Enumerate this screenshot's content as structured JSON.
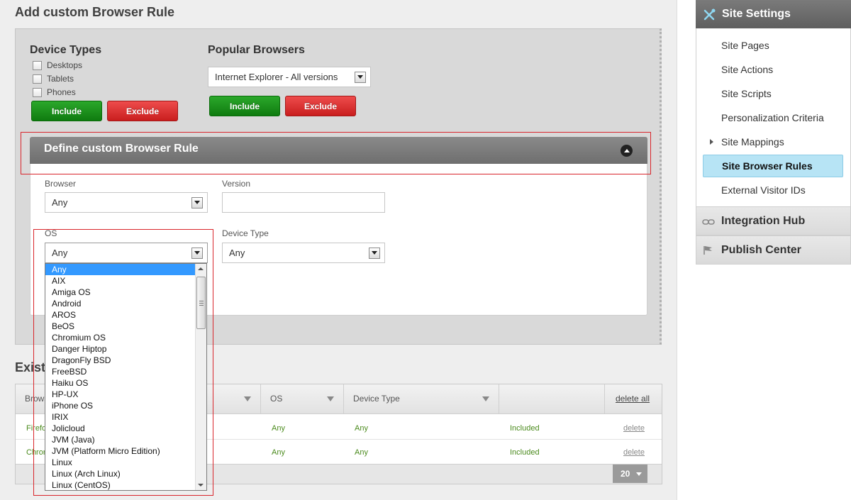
{
  "page": {
    "title": "Add custom Browser Rule",
    "existing_title": "Existing Browser Rules"
  },
  "device_types": {
    "heading": "Device Types",
    "options": [
      "Desktops",
      "Tablets",
      "Phones"
    ],
    "include_label": "Include",
    "exclude_label": "Exclude"
  },
  "popular_browsers": {
    "heading": "Popular Browsers",
    "selected": "Internet Explorer - All versions",
    "include_label": "Include",
    "exclude_label": "Exclude"
  },
  "define_rule": {
    "title": "Define custom Browser Rule",
    "browser_label": "Browser",
    "browser_value": "Any",
    "version_label": "Version",
    "version_value": "",
    "os_label": "OS",
    "os_value": "Any",
    "device_type_label": "Device Type",
    "device_type_value": "Any",
    "os_options": [
      "Any",
      "AIX",
      "Amiga OS",
      "Android",
      "AROS",
      "BeOS",
      "Chromium OS",
      "Danger Hiptop",
      "DragonFly BSD",
      "FreeBSD",
      "Haiku OS",
      "HP-UX",
      "iPhone OS",
      "IRIX",
      "Jolicloud",
      "JVM (Java)",
      "JVM (Platform Micro Edition)",
      "Linux",
      "Linux (Arch Linux)",
      "Linux (CentOS)"
    ]
  },
  "table": {
    "headers": {
      "browser": "Browser",
      "os": "OS",
      "device_type": "Device Type",
      "delete_all": "delete all"
    },
    "rows": [
      {
        "browser": "Firefox",
        "os": "Any",
        "device_type": "Any",
        "status": "Included",
        "action": "delete"
      },
      {
        "browser": "Chrome",
        "os": "Any",
        "device_type": "Any",
        "status": "Included",
        "action": "delete"
      }
    ],
    "page_size": "20"
  },
  "sidebar": {
    "header": "Site Settings",
    "header_icon": "tools-icon",
    "items": [
      "Site Pages",
      "Site Actions",
      "Site Scripts",
      "Personalization Criteria",
      "Site Mappings",
      "Site Browser Rules",
      "External Visitor IDs"
    ],
    "active": "Site Browser Rules",
    "sections": [
      "Integration Hub",
      "Publish Center"
    ],
    "accent_color": "#b7e4f5"
  }
}
